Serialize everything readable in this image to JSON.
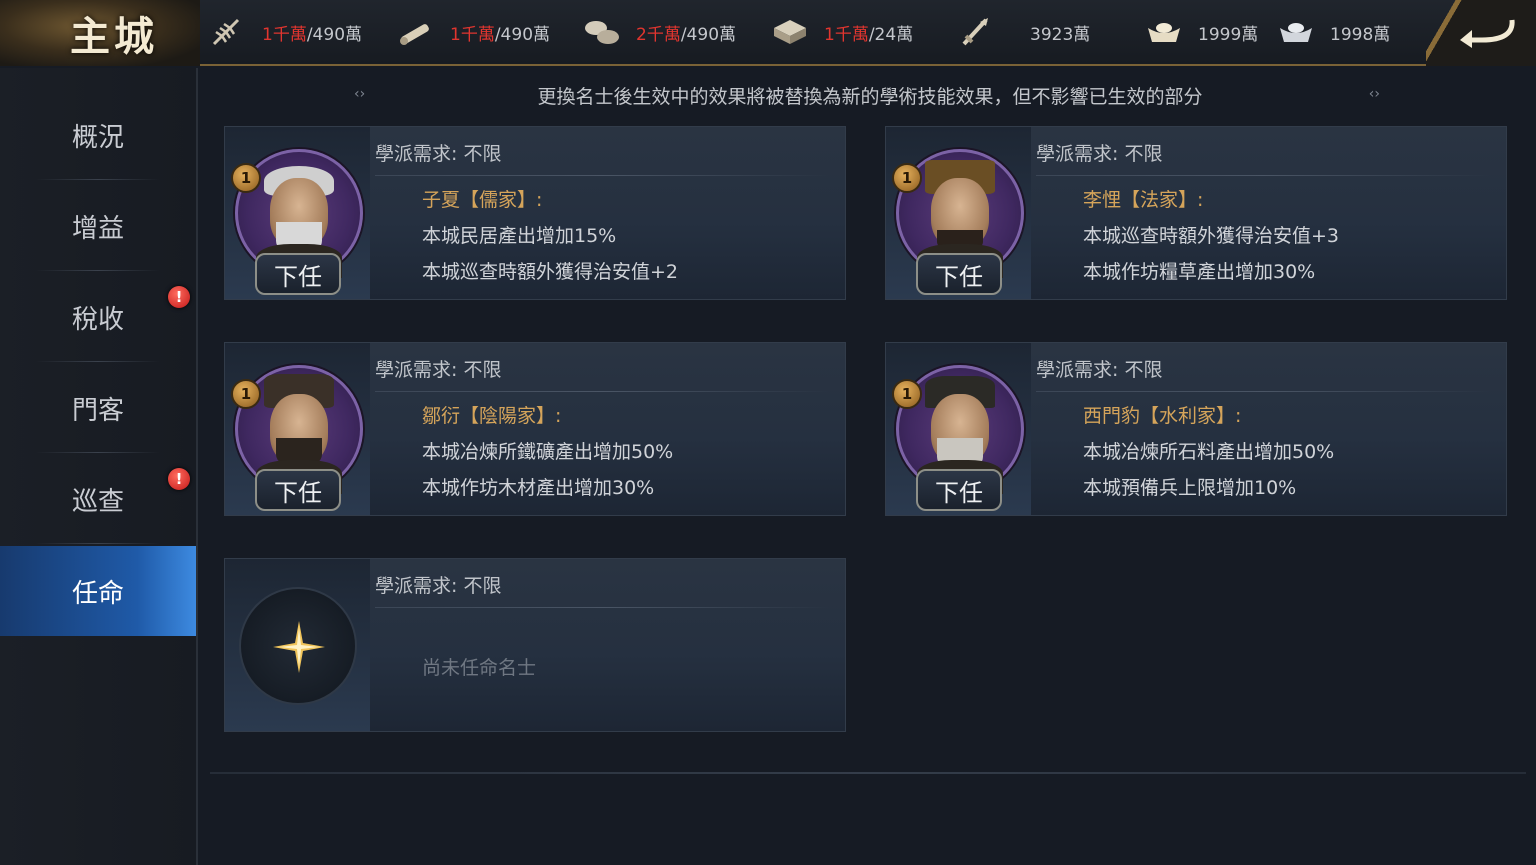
{
  "header": {
    "title": "主城",
    "resources": [
      {
        "icon": "grain-icon",
        "current": "1千萬",
        "cap": "/490萬",
        "over_cap": true
      },
      {
        "icon": "wood-icon",
        "current": "1千萬",
        "cap": "/490萬",
        "over_cap": true
      },
      {
        "icon": "stone-icon",
        "current": "2千萬",
        "cap": "/490萬",
        "over_cap": true
      },
      {
        "icon": "iron-icon",
        "current": "1千萬",
        "cap": "/24萬",
        "over_cap": true
      },
      {
        "icon": "troops-icon",
        "value": "3923萬"
      },
      {
        "icon": "gold-ingot-icon",
        "value": "1999萬"
      },
      {
        "icon": "silver-ingot-icon",
        "value": "1998萬"
      }
    ]
  },
  "sidebar": {
    "items": [
      {
        "label": "概況",
        "alert": false,
        "active": false
      },
      {
        "label": "增益",
        "alert": false,
        "active": false
      },
      {
        "label": "稅收",
        "alert": true,
        "active": false
      },
      {
        "label": "門客",
        "alert": false,
        "active": false
      },
      {
        "label": "巡查",
        "alert": true,
        "active": false
      },
      {
        "label": "任命",
        "alert": false,
        "active": true
      }
    ],
    "alert_mark": "!"
  },
  "notice": {
    "text": "更換名士後生效中的效果將被替換為新的學術技能效果，但不影響已生效的部分",
    "left_arrow": "‹›",
    "right_arrow": "‹›"
  },
  "cards": [
    {
      "requirement": "學派需求:  不限",
      "level": "1",
      "skill": "子夏【儒家】:",
      "effects": [
        "本城民居產出增加15%",
        "本城巡查時額外獲得治安值+2"
      ],
      "button": "下任"
    },
    {
      "requirement": "學派需求:  不限",
      "level": "1",
      "skill": "李悝【法家】:",
      "effects": [
        "本城巡查時額外獲得治安值+3",
        "本城作坊糧草產出增加30%"
      ],
      "button": "下任"
    },
    {
      "requirement": "學派需求:  不限",
      "level": "1",
      "skill": "鄒衍【陰陽家】:",
      "effects": [
        "本城冶煉所鐵礦產出增加50%",
        "本城作坊木材產出增加30%"
      ],
      "button": "下任"
    },
    {
      "requirement": "學派需求:  不限",
      "level": "1",
      "skill": "西門豹【水利家】:",
      "effects": [
        "本城冶煉所石料產出增加50%",
        "本城預備兵上限增加10%"
      ],
      "button": "下任"
    }
  ],
  "empty_card": {
    "requirement": "學派需求:  不限",
    "placeholder": "尚未任命名士"
  },
  "colors": {
    "accent_gold": "#d5a45a",
    "alert_red": "#e0352f",
    "active_blue": "#1f5aa8",
    "portrait_ring": "#7c62a6"
  }
}
